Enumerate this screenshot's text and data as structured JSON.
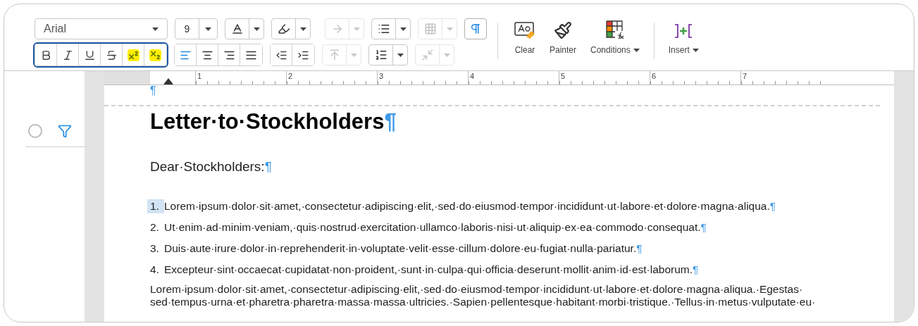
{
  "toolbar": {
    "font_field": "Arial",
    "size_field": "9",
    "top_row": [
      {
        "kind": "font-color",
        "dropdown": true,
        "disabled": false
      },
      {
        "kind": "highlight",
        "dropdown": true,
        "disabled": false
      },
      {
        "kind": "text-direction",
        "dropdown": true,
        "disabled": true
      },
      {
        "kind": "bullets",
        "dropdown": true,
        "disabled": false
      },
      {
        "kind": "borders",
        "dropdown": true,
        "disabled": true
      },
      {
        "kind": "pilcrow",
        "dropdown": false,
        "disabled": false,
        "selected": true
      }
    ],
    "format_group": {
      "framed": true,
      "buttons": [
        {
          "kind": "bold",
          "selected": false
        },
        {
          "kind": "italic",
          "selected": false
        },
        {
          "kind": "underline",
          "selected": false
        },
        {
          "kind": "strikethrough",
          "selected": false
        },
        {
          "kind": "superscript",
          "selected": true
        },
        {
          "kind": "subscript",
          "selected": true
        }
      ]
    },
    "align_group": [
      {
        "kind": "align-left",
        "selected": true
      },
      {
        "kind": "align-center",
        "selected": false
      },
      {
        "kind": "align-right",
        "selected": false
      },
      {
        "kind": "align-justify",
        "selected": false
      }
    ],
    "indent_group": [
      {
        "kind": "outdent"
      },
      {
        "kind": "indent"
      }
    ],
    "bottom_row": [
      {
        "kind": "spacing",
        "dropdown": true,
        "disabled": true
      },
      {
        "kind": "numbering",
        "dropdown": true,
        "disabled": false
      },
      {
        "kind": "margins",
        "dropdown": true,
        "disabled": true
      }
    ],
    "actions": [
      {
        "kind": "clear",
        "label": "Clear",
        "menu": false
      },
      {
        "kind": "painter",
        "label": "Painter",
        "menu": false
      },
      {
        "kind": "conditions",
        "label": "Conditions",
        "menu": true
      },
      {
        "kind": "insert",
        "label": "Insert",
        "menu": true
      }
    ]
  },
  "ruler": {
    "marks": [
      "1",
      "2",
      "3",
      "4",
      "5",
      "6",
      "7"
    ]
  },
  "sidebar": {
    "checked": false
  },
  "document": {
    "empty_mark": "¶",
    "title": "Letter·to·Stockholders",
    "title_mark": "¶",
    "greeting": "Dear·Stockholders:",
    "greeting_mark": "¶",
    "list": [
      {
        "number": "1.",
        "text": "Lorem·ipsum·dolor·sit·amet,·consectetur·adipiscing·elit,·sed·do·eiusmod·tempor·incididunt·ut·labore·et·dolore·magna·aliqua.",
        "mark": "¶",
        "selected": true
      },
      {
        "number": "2.",
        "text": "Ut·enim·ad·minim·veniam,·quis·nostrud·exercitation·ullamco·laboris·nisi·ut·aliquip·ex·ea·commodo·consequat.",
        "mark": "¶",
        "selected": false
      },
      {
        "number": "3.",
        "text": "Duis·aute·irure·dolor·in·reprehenderit·in·voluptate·velit·esse·cillum·dolore·eu·fugiat·nulla·pariatur.",
        "mark": "¶",
        "selected": false
      },
      {
        "number": "4.",
        "text": "Excepteur·sint·occaecat·cupidatat·non·proident,·sunt·in·culpa·qui·officia·deserunt·mollit·anim·id·est·laborum.",
        "mark": "¶",
        "selected": false
      }
    ],
    "paragraph_lines": [
      "Lorem·ipsum·dolor·sit·amet,·consectetur·adipiscing·elit,·sed·do·eiusmod·tempor·incididunt·ut·labore·et·dolore·magna·aliqua.·Egestas·",
      "sed·tempus·urna·et·pharetra·pharetra·massa·massa·ultricies.·Sapien·pellentesque·habitant·morbi·tristique.·Tellus·in·metus·vulputate·eu·"
    ]
  }
}
